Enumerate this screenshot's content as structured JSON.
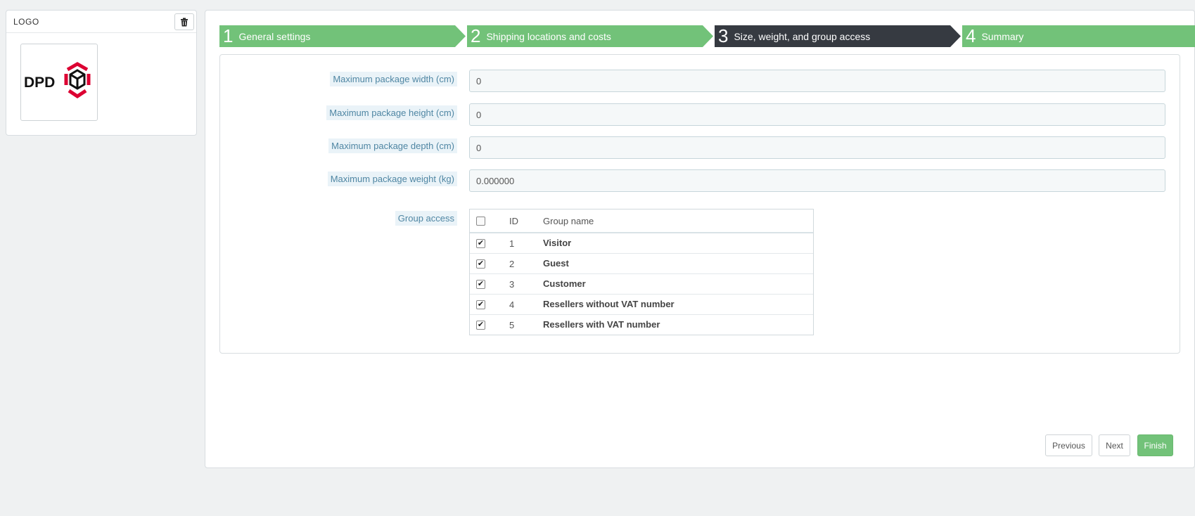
{
  "logo_panel": {
    "title": "LOGO",
    "logo_text": "DPD"
  },
  "steps": [
    {
      "num": "1",
      "label": "General settings",
      "state": "done"
    },
    {
      "num": "2",
      "label": "Shipping locations and costs",
      "state": "done"
    },
    {
      "num": "3",
      "label": "Size, weight, and group access",
      "state": "current"
    },
    {
      "num": "4",
      "label": "Summary",
      "state": "done"
    }
  ],
  "form": {
    "max_width": {
      "label": "Maximum package width (cm)",
      "value": "0"
    },
    "max_height": {
      "label": "Maximum package height (cm)",
      "value": "0"
    },
    "max_depth": {
      "label": "Maximum package depth (cm)",
      "value": "0"
    },
    "max_weight": {
      "label": "Maximum package weight (kg)",
      "value": "0.000000"
    },
    "group_access": {
      "label": "Group access",
      "headers": {
        "id": "ID",
        "name": "Group name"
      },
      "groups": [
        {
          "id": "1",
          "name": "Visitor",
          "checked": true
        },
        {
          "id": "2",
          "name": "Guest",
          "checked": true
        },
        {
          "id": "3",
          "name": "Customer",
          "checked": true
        },
        {
          "id": "4",
          "name": "Resellers without VAT number",
          "checked": true
        },
        {
          "id": "5",
          "name": "Resellers with VAT number",
          "checked": true
        }
      ]
    }
  },
  "buttons": {
    "previous": "Previous",
    "next": "Next",
    "finish": "Finish"
  },
  "colors": {
    "step_done": "#72c279",
    "step_current": "#363a41",
    "finish_button": "#72c279",
    "label_bg": "#eaf3f8",
    "label_text": "#4f86a3",
    "page_bg": "#eff1f2"
  }
}
